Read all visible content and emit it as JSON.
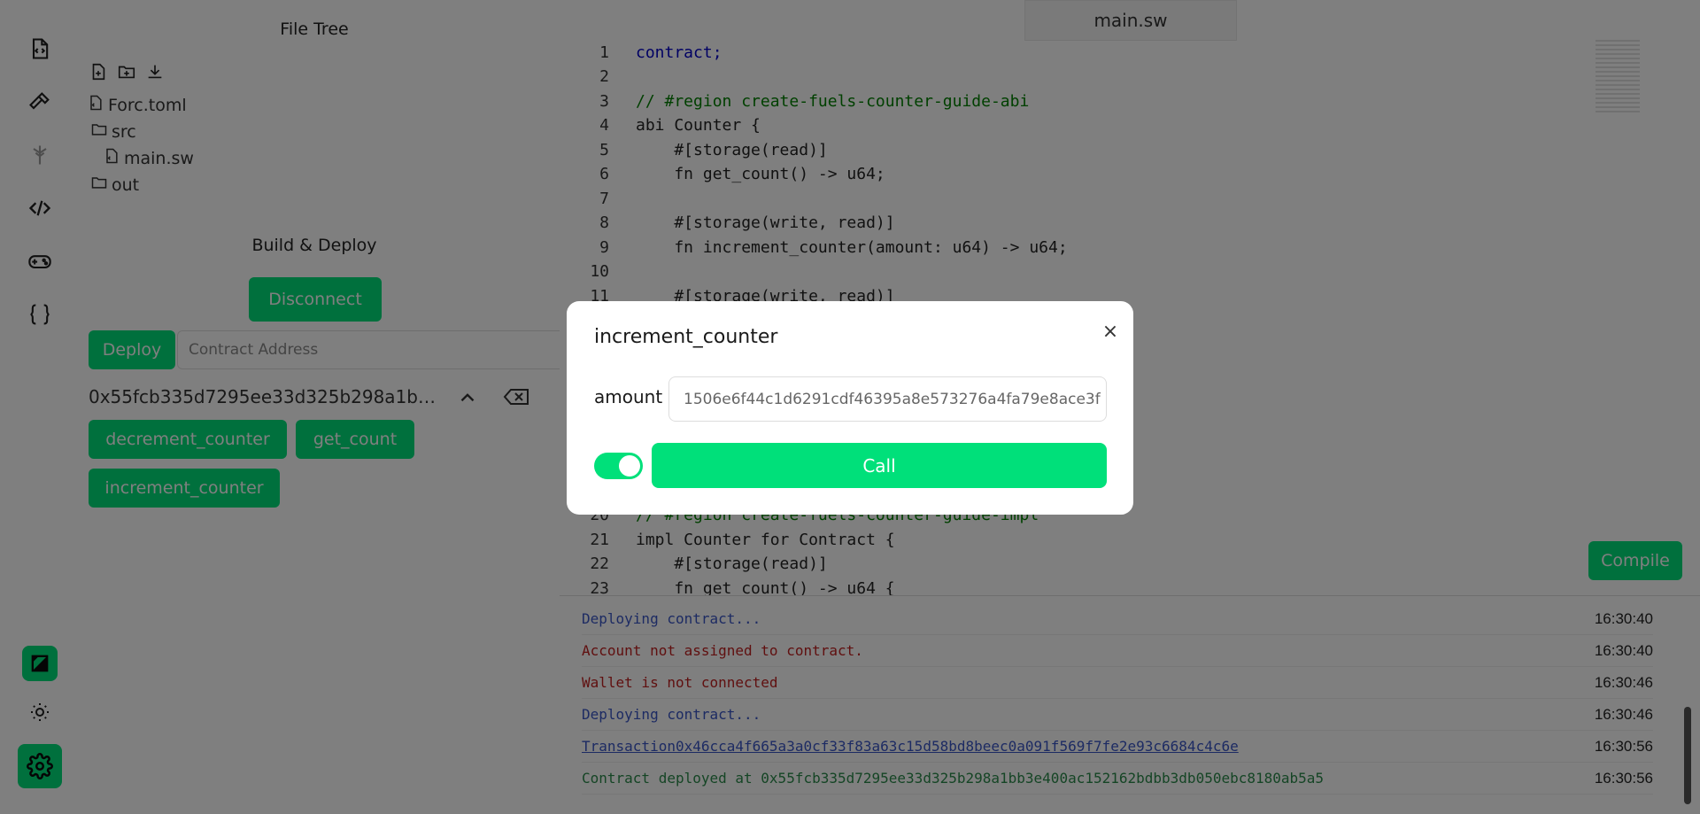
{
  "rail": {
    "items": [
      {
        "icon": "file-code-icon"
      },
      {
        "icon": "hammer-icon"
      },
      {
        "icon": "antenna-icon"
      },
      {
        "icon": "code-icon"
      },
      {
        "icon": "gamepad-icon"
      },
      {
        "icon": "braces-icon"
      }
    ],
    "bottom": [
      {
        "icon": "fuel-logo-icon"
      },
      {
        "icon": "sun-icon"
      },
      {
        "icon": "gear-icon"
      }
    ]
  },
  "file_tree": {
    "title": "File Tree",
    "items": [
      {
        "label": "Forc.toml",
        "type": "file"
      },
      {
        "label": "src",
        "type": "folder"
      },
      {
        "label": "main.sw",
        "type": "file"
      },
      {
        "label": "out",
        "type": "folder"
      }
    ]
  },
  "build_deploy": {
    "title": "Build & Deploy",
    "disconnect_label": "Disconnect",
    "deploy_label": "Deploy",
    "contract_address_placeholder": "Contract Address",
    "contract_address": "0x55fcb335d7295ee33d325b298a1bb3e400ac152162bdbb3db050ebc8180ab5a5",
    "functions": [
      "decrement_counter",
      "get_count",
      "increment_counter"
    ]
  },
  "editor": {
    "tab": "main.sw",
    "compile_label": "Compile",
    "lines": [
      {
        "n": "1",
        "text": "contract;"
      },
      {
        "n": "2",
        "text": ""
      },
      {
        "n": "3",
        "text": "// #region create-fuels-counter-guide-abi"
      },
      {
        "n": "4",
        "text": "abi Counter {"
      },
      {
        "n": "5",
        "text": "    #[storage(read)]"
      },
      {
        "n": "6",
        "text": "    fn get_count() -> u64;"
      },
      {
        "n": "7",
        "text": ""
      },
      {
        "n": "8",
        "text": "    #[storage(write, read)]"
      },
      {
        "n": "9",
        "text": "    fn increment_counter(amount: u64) -> u64;"
      },
      {
        "n": "10",
        "text": ""
      },
      {
        "n": "11",
        "text": "    #[storage(write, read)]"
      },
      {
        "n": "20",
        "text": "// #region create-fuels-counter-guide-impl"
      },
      {
        "n": "21",
        "text": "impl Counter for Contract {"
      },
      {
        "n": "22",
        "text": "    #[storage(read)]"
      },
      {
        "n": "23",
        "text": "    fn get_count() -> u64 {"
      }
    ]
  },
  "console": {
    "logs": [
      {
        "text": "Deploying contract...",
        "time": "16:30:40",
        "color": "#3a56c6"
      },
      {
        "text": "Account not assigned to contract.",
        "time": "16:30:40",
        "color": "#c02020"
      },
      {
        "text": "Wallet is not connected",
        "time": "16:30:46",
        "color": "#c02020"
      },
      {
        "text": "Deploying contract...",
        "time": "16:30:46",
        "color": "#3a56c6"
      },
      {
        "text": "Transaction0x46cca4f665a3a0cf33f83a63c15d58bd8beec0a091f569f7fe2e93c6684c4c6e",
        "time": "16:30:56",
        "color": "#3a56c6"
      },
      {
        "text": "Contract deployed at 0x55fcb335d7295ee33d325b298a1bb3e400ac152162bdbb3db050ebc8180ab5a5",
        "time": "16:30:56",
        "color": "#2a8a4a"
      }
    ]
  },
  "modal": {
    "title": "increment_counter",
    "close_label": "×",
    "amount_label": "amount",
    "amount_value": "1506e6f44c1d6291cdf46395a8e573276a4fa79e8ace3f",
    "toggle_on": true,
    "call_label": "Call"
  },
  "colors": {
    "accent": "#00e07a",
    "overlay": "rgba(0,0,0,0.5)"
  }
}
